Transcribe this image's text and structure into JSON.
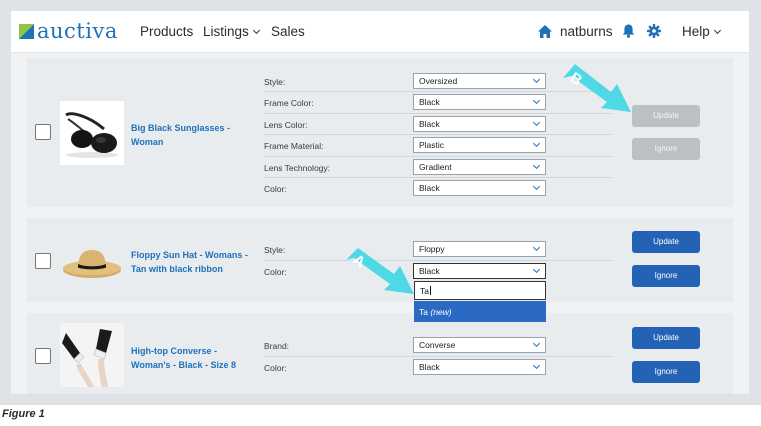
{
  "header": {
    "logo_text": "auctiva",
    "nav": {
      "products": "Products",
      "listings": "Listings",
      "sales": "Sales",
      "help": "Help"
    },
    "username": "natburns",
    "icons": [
      "home-icon",
      "bell-icon",
      "gear-icon"
    ]
  },
  "products": [
    {
      "name": "Big Black Sunglasses - Woman",
      "checked": false,
      "specifics": [
        {
          "label": "Style:",
          "value": "Oversized"
        },
        {
          "label": "Frame Color:",
          "value": "Black"
        },
        {
          "label": "Lens Color:",
          "value": "Black"
        },
        {
          "label": "Frame Material:",
          "value": "Plastic"
        },
        {
          "label": "Lens Technology:",
          "value": "Gradient"
        },
        {
          "label": "Color:",
          "value": "Black"
        }
      ],
      "update_label": "Update",
      "ignore_label": "Ignore",
      "buttons_state": "disabled"
    },
    {
      "name": "Floppy Sun Hat - Womans - Tan with black ribbon",
      "checked": false,
      "specifics": [
        {
          "label": "Style:",
          "value": "Floppy"
        },
        {
          "label": "Color:",
          "value": "Black"
        }
      ],
      "typed_value": "Ta",
      "suggestion": {
        "value": "Ta",
        "suffix": "(new)"
      },
      "update_label": "Update",
      "ignore_label": "Ignore",
      "buttons_state": "enabled"
    },
    {
      "name": "High-top Converse - Woman's - Black - Size 8",
      "checked": false,
      "specifics": [
        {
          "label": "Brand:",
          "value": "Converse"
        },
        {
          "label": "Color:",
          "value": "Black"
        }
      ],
      "update_label": "Update",
      "ignore_label": "Ignore",
      "buttons_state": "enabled"
    }
  ],
  "callouts": {
    "a": "A",
    "b": "B"
  },
  "caption": "Figure 1",
  "colors": {
    "brand_blue": "#1f71b8",
    "button_blue": "#2462b5",
    "button_disabled": "#bcc0c4",
    "callout_cyan": "#4fd8e6",
    "logo_green": "#8dc63f"
  }
}
